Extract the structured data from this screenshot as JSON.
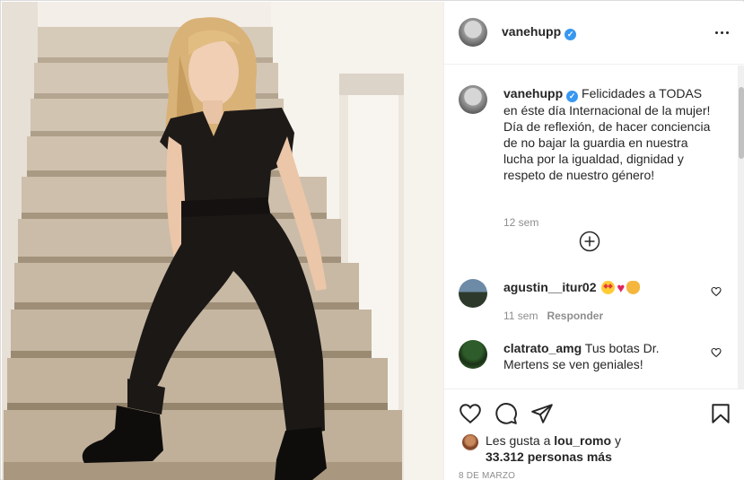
{
  "post": {
    "username": "vanehupp",
    "verified_mark": "✓",
    "more_icon": "more-options-icon"
  },
  "caption": {
    "username": "vanehupp",
    "text": "Felicidades a TODAS en éste día Internacional de la mujer! Día de reflexión, de hacer conciencia de no bajar la guardia en nuestra lucha por la igualdad, dignidad y respeto de nuestro género!",
    "time": "12 sem"
  },
  "comments": [
    {
      "username": "agustin__itur02",
      "text": "",
      "emojis": [
        "star-struck-emoji",
        "red-heart-emoji",
        "clapping-hands-emoji"
      ],
      "time": "11 sem",
      "reply_label": "Responder"
    },
    {
      "username": "clatrato_amg",
      "text": "Tus botas Dr. Mertens se ven geniales!"
    }
  ],
  "likes": {
    "prefix": "Les gusta a",
    "liker": "lou_romo",
    "conjunction": "y",
    "count": "33.312",
    "suffix": "personas más"
  },
  "date": "8 DE MARZO",
  "colors": {
    "verified": "#3897f0",
    "text": "#262626",
    "secondary": "#8e8e8e",
    "border": "#dbdbdb"
  }
}
